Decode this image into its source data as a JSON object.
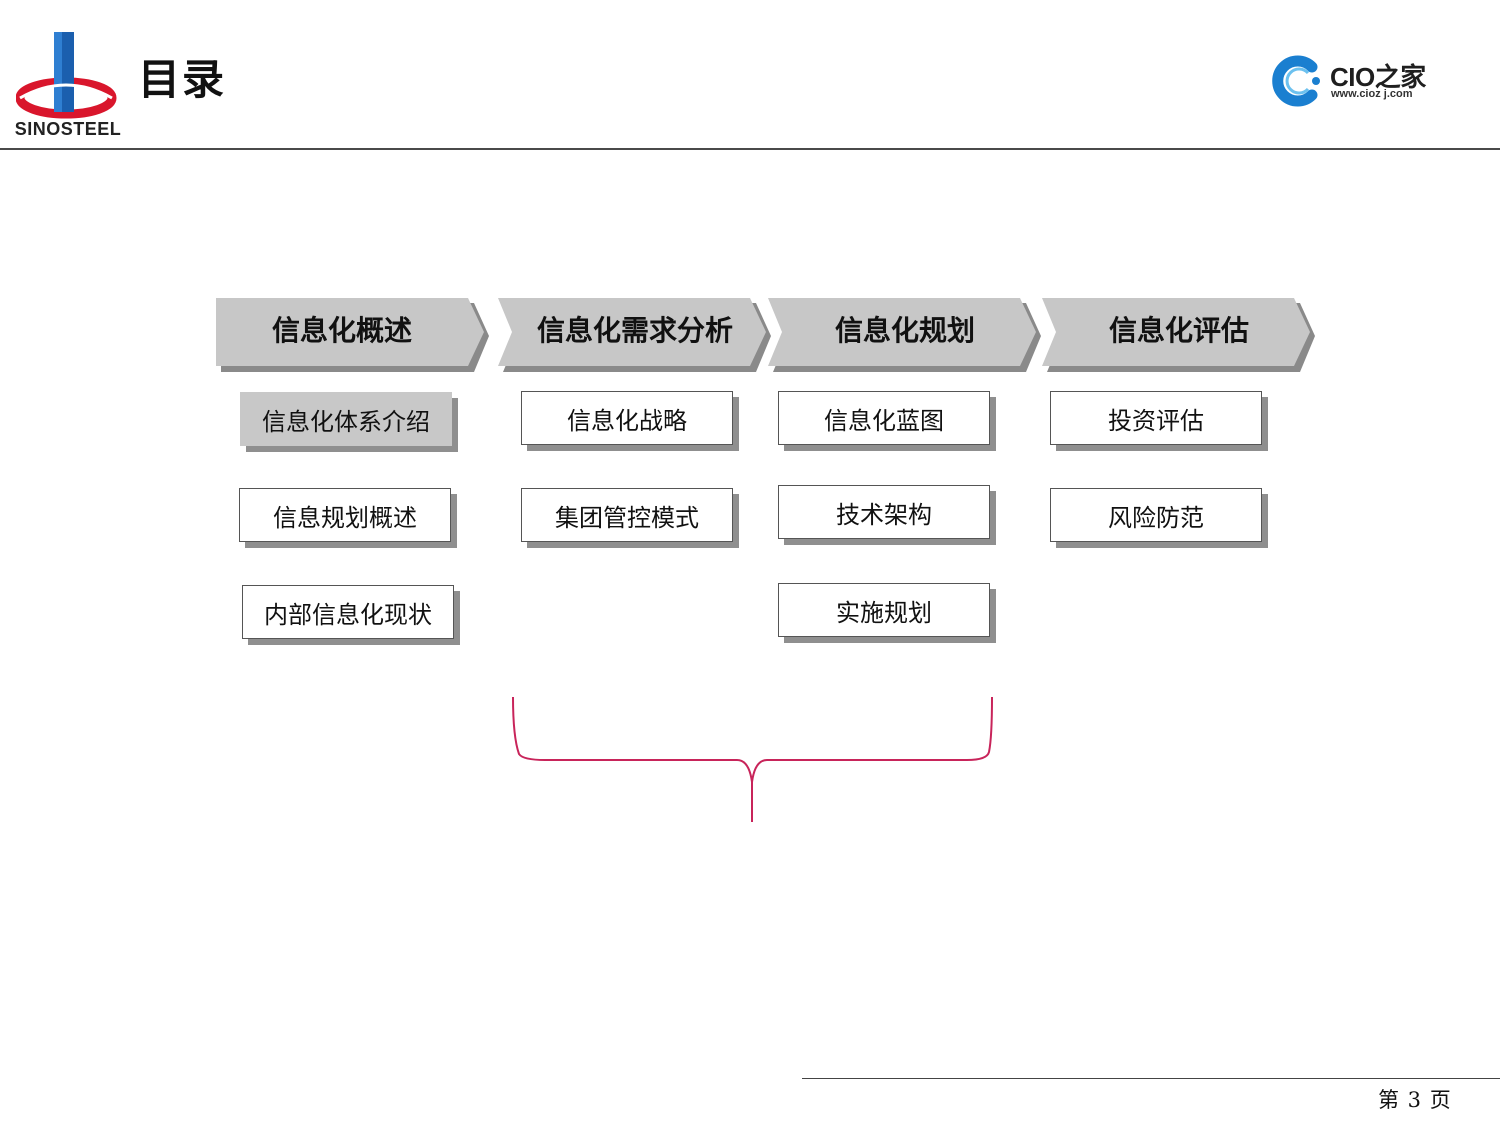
{
  "header": {
    "title": "目录",
    "brand_left": "SINOSTEEL",
    "brand_right_name": "CIO之家",
    "brand_right_url": "www.cioz j.com"
  },
  "columns": [
    {
      "label": "信息化概述",
      "items": [
        "信息化体系介绍",
        "信息规划概述",
        "内部信息化现状"
      ]
    },
    {
      "label": "信息化需求分析",
      "items": [
        "信息化战略",
        "集团管控模式"
      ]
    },
    {
      "label": "信息化规划",
      "items": [
        "信息化蓝图",
        "技术架构",
        "实施规划"
      ]
    },
    {
      "label": "信息化评估",
      "items": [
        "投资评估",
        "风险防范"
      ]
    }
  ],
  "footer": {
    "page": "第 3 页"
  },
  "colors": {
    "chevron_fill": "#c7c7c7",
    "chevron_shadow": "#8a8a8a",
    "brace": "#c8245a",
    "logo_red": "#d9162c",
    "logo_blue": "#1d6fc0"
  }
}
